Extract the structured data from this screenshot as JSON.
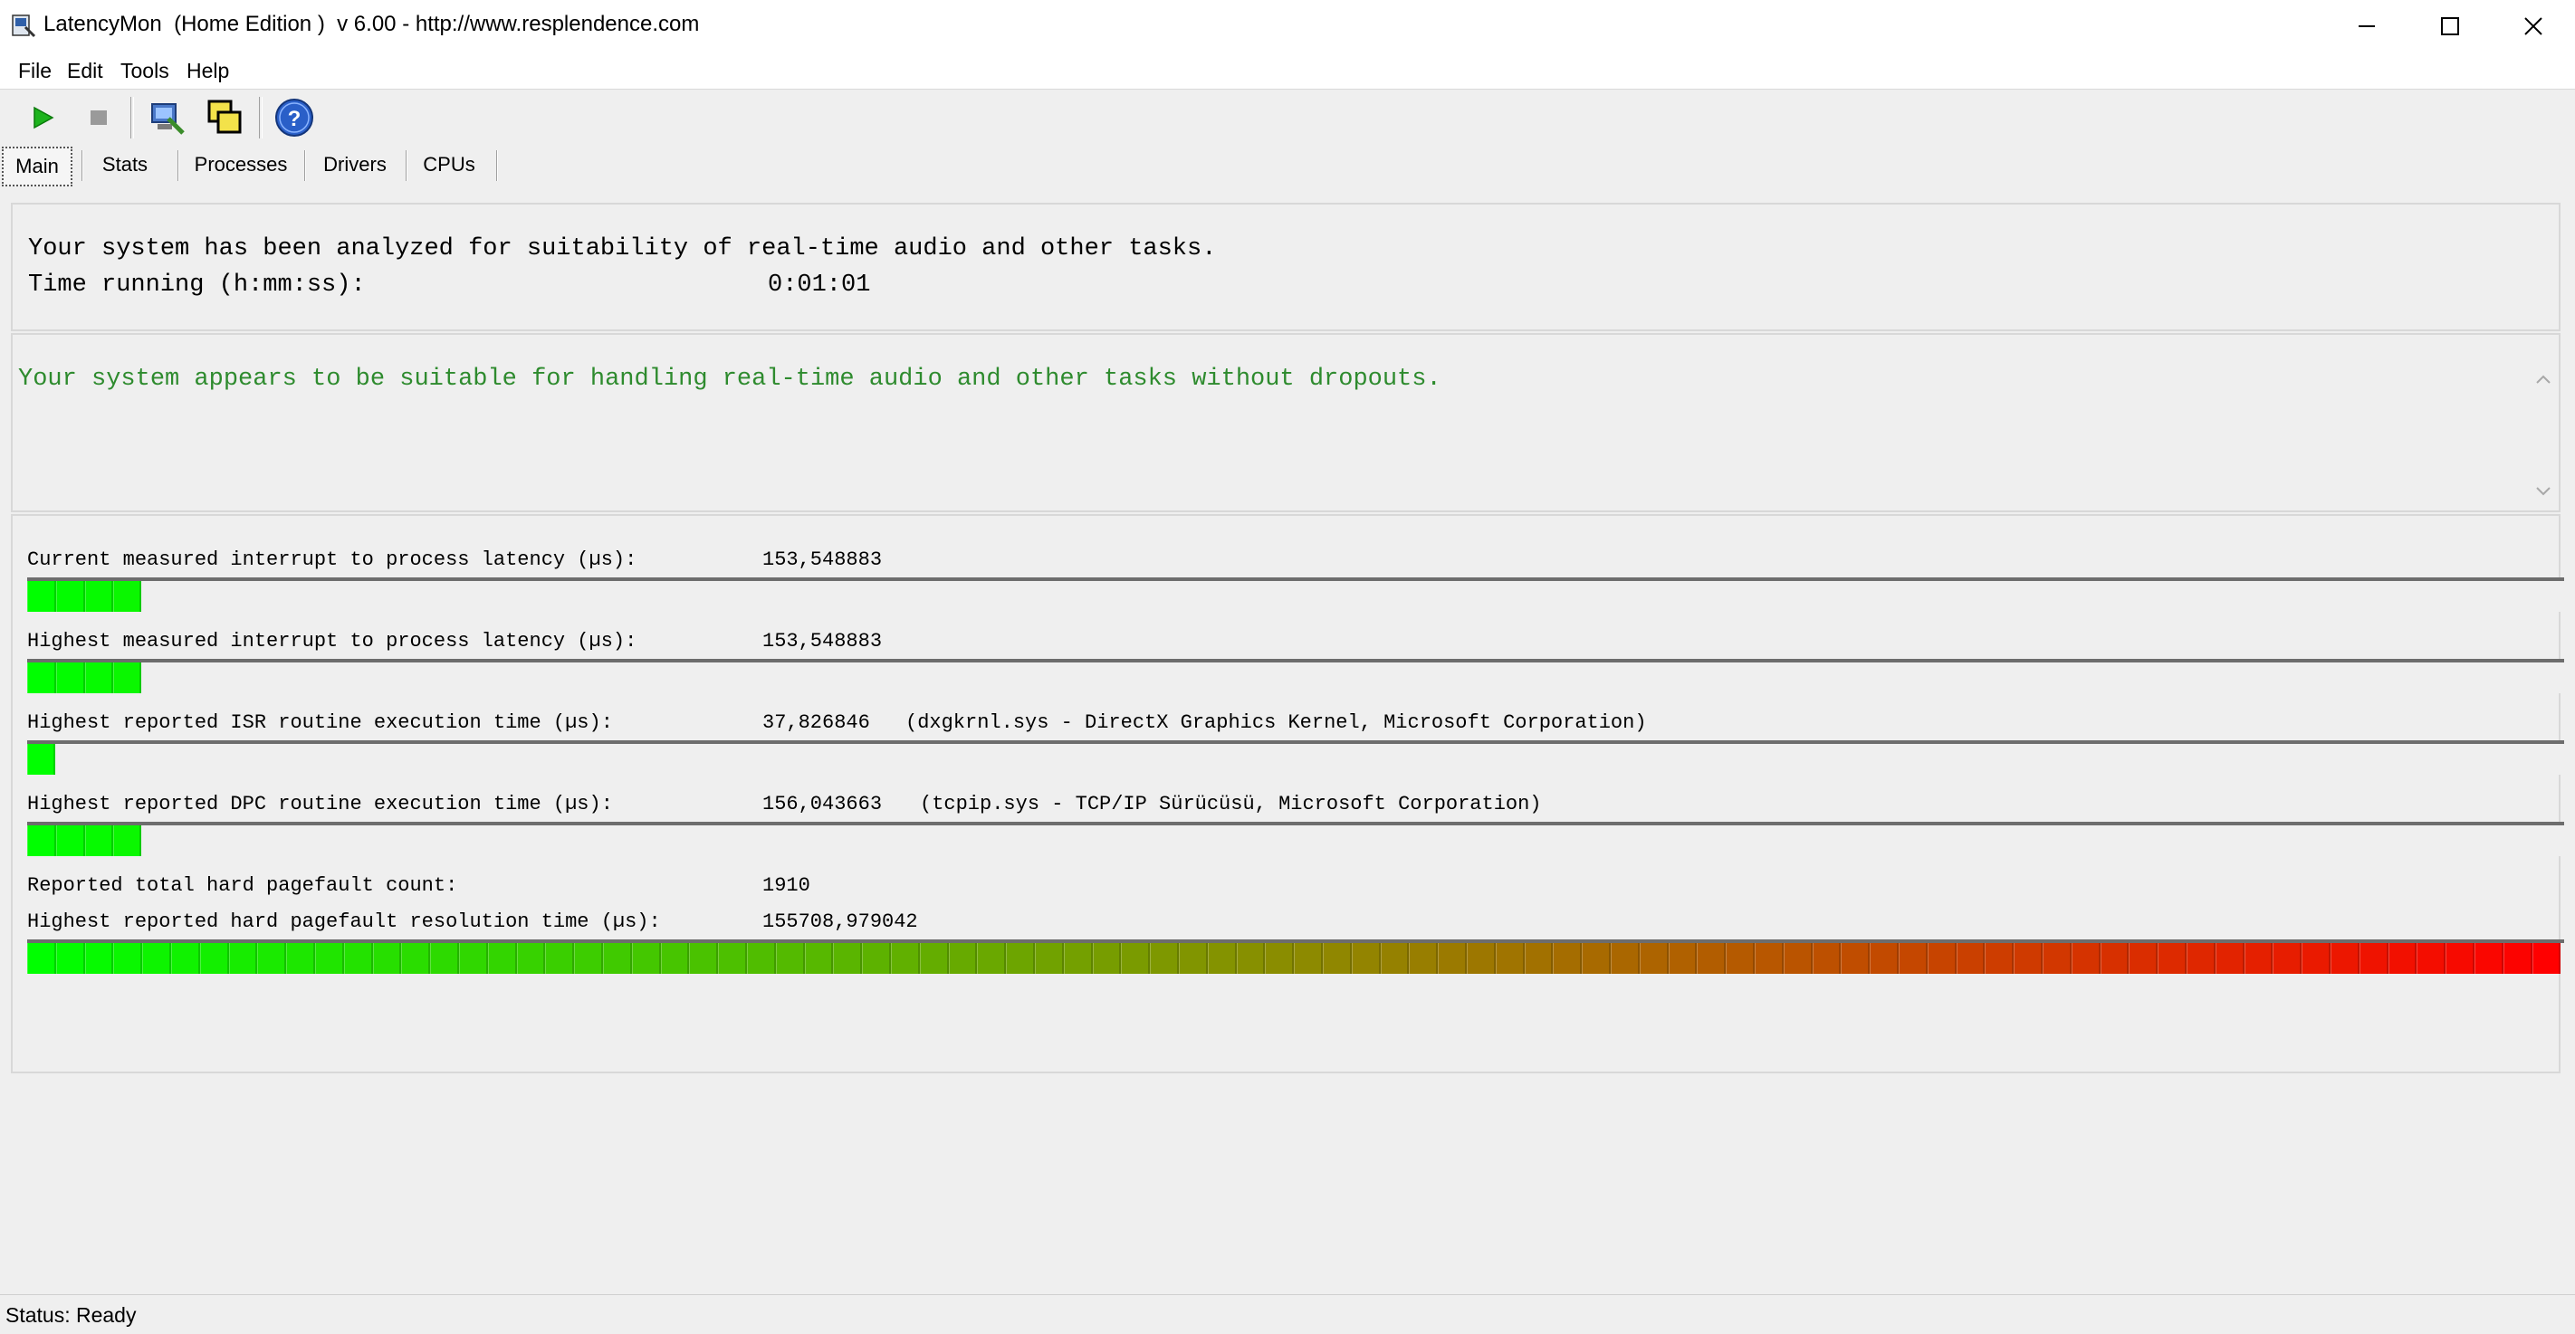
{
  "window": {
    "title": "LatencyMon  (Home Edition )  v 6.00 - http://www.resplendence.com",
    "controls": {
      "minimize": "–",
      "maximize": "☐",
      "close": "✕"
    }
  },
  "menu": [
    "File",
    "Edit",
    "Tools",
    "Help"
  ],
  "toolbar": {
    "icons": [
      "start-icon",
      "stop-icon",
      "computer-tools-icon",
      "windows-icon",
      "help-icon"
    ],
    "help_glyph": "?"
  },
  "tabs": [
    "Main",
    "Stats",
    "Processes",
    "Drivers",
    "CPUs"
  ],
  "active_tab": "Main",
  "summary": {
    "line1": "Your system has been analyzed for suitability of real-time audio and other tasks.",
    "time_label": "Time running (h:mm:ss):",
    "time_value": "0:01:01"
  },
  "verdict": {
    "message": "Your system appears to be suitable for handling real-time audio and other tasks without dropouts.",
    "color": "#2e8b2e"
  },
  "metrics": [
    {
      "label": "Current measured interrupt to process latency (µs):",
      "value": "153,548883",
      "detail": "",
      "level": 0.045
    },
    {
      "label": "Highest measured interrupt to process latency (µs):",
      "value": "153,548883",
      "detail": "",
      "level": 0.045
    },
    {
      "label": "Highest reported ISR routine execution time (µs):",
      "value": "37,826846",
      "detail": "(dxgkrnl.sys - DirectX Graphics Kernel, Microsoft Corporation)",
      "level": 0.011
    },
    {
      "label": "Highest reported DPC routine execution time (µs):",
      "value": "156,043663",
      "detail": "(tcpip.sys - TCP/IP Sürücüsü, Microsoft Corporation)",
      "level": 0.045
    }
  ],
  "pagefault": {
    "count_label": "Reported total hard pagefault count:",
    "count_value": "1910",
    "time_label": "Highest reported hard pagefault resolution time (µs):",
    "time_value": "155708,979042",
    "level": 1.0
  },
  "status": "Status: Ready",
  "colors": {
    "bar_low": "#00ff00",
    "bar_mid": "#8c8c00",
    "bar_high": "#ff0000"
  }
}
